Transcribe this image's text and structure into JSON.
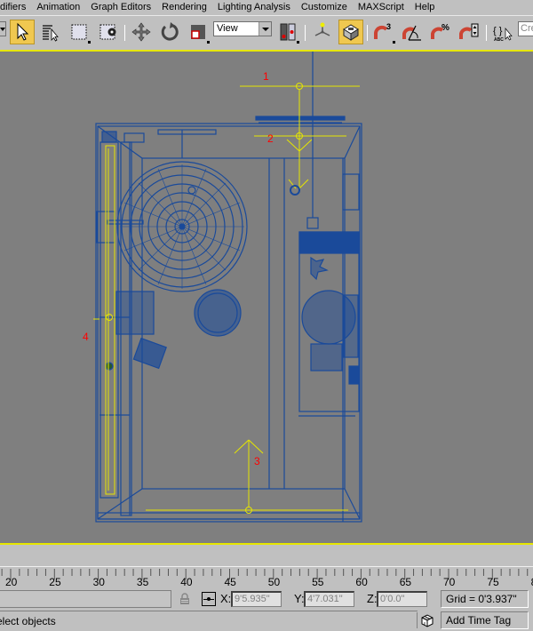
{
  "menubar": {
    "items": [
      "difiers",
      "Animation",
      "Graph Editors",
      "Rendering",
      "Lighting Analysis",
      "Customize",
      "MAXScript",
      "Help"
    ]
  },
  "toolbar": {
    "view_dropdown": "View",
    "named_selection_placeholder": "Cre",
    "buttons": [
      {
        "name": "select-object",
        "active": true
      },
      {
        "name": "select-by-name",
        "active": false
      },
      {
        "name": "rectangular-selection-region",
        "active": false
      },
      {
        "name": "window-crossing",
        "active": false
      },
      {
        "name": "select-and-move",
        "active": false
      },
      {
        "name": "select-and-rotate",
        "active": false
      },
      {
        "name": "select-and-scale",
        "active": false
      },
      {
        "name": "use-pivot-center",
        "active": false
      },
      {
        "name": "select-and-manipulate",
        "active": false
      },
      {
        "name": "keyboard-shortcut-override",
        "active": true
      },
      {
        "name": "snaps-toggle-3",
        "label": "3",
        "active": false
      },
      {
        "name": "angle-snap",
        "active": false
      },
      {
        "name": "percent-snap",
        "label": "%",
        "active": false
      },
      {
        "name": "spinner-snap",
        "active": false
      },
      {
        "name": "edit-named-selection-sets",
        "label": "ABC",
        "active": false
      }
    ]
  },
  "viewport": {
    "background": "#7f7f7f",
    "border_color": "#e6e600",
    "wire_color": "#1a4a9a",
    "selection_color": "#e6e600",
    "label_color": "#ff0000",
    "labels": [
      "1",
      "2",
      "3",
      "4"
    ]
  },
  "timeline": {
    "ticks": [
      "20",
      "25",
      "30",
      "35",
      "40",
      "45",
      "50",
      "55",
      "60",
      "65",
      "70",
      "75",
      "8"
    ]
  },
  "status": {
    "x_label": "X:",
    "x_value": "9'5.935\"",
    "y_label": "Y:",
    "y_value": "4'7.031\"",
    "z_label": "Z:",
    "z_value": "0'0.0\"",
    "grid": "Grid = 0'3.937\"",
    "prompt": "elect objects",
    "add_time_tag": "Add Time Tag"
  }
}
